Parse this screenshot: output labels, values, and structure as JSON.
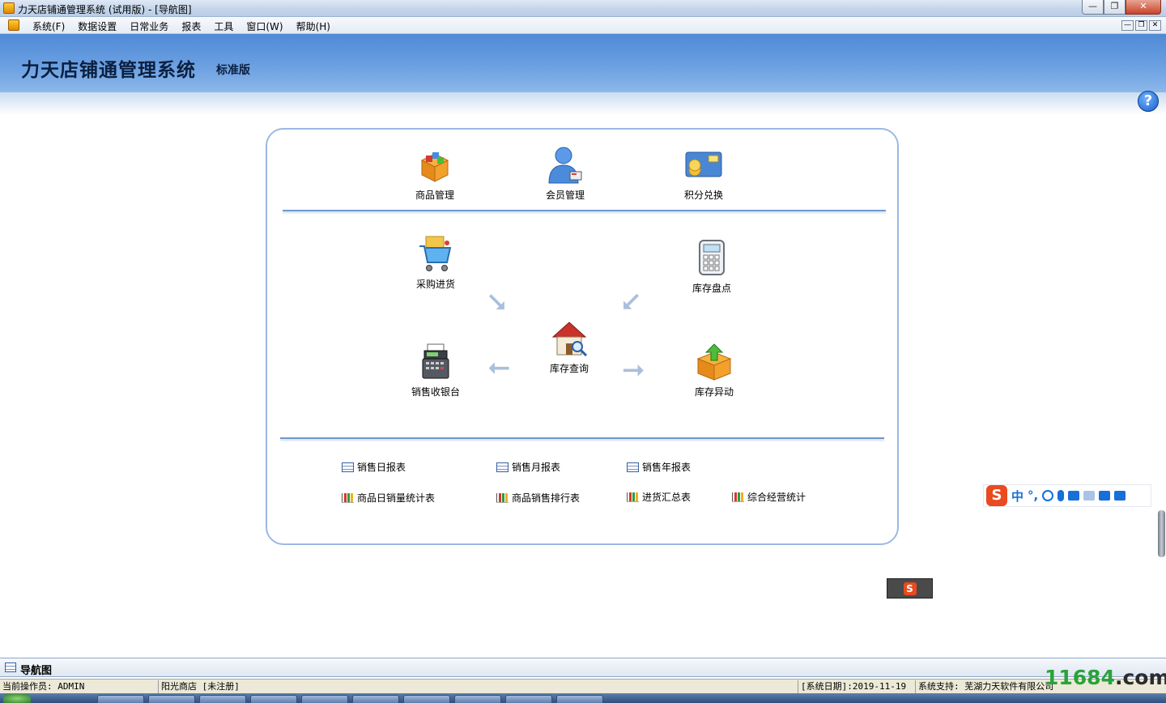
{
  "window": {
    "title": "力天店铺通管理系统 (试用版) - [导航图]",
    "min_glyph": "—",
    "max_glyph": "❐",
    "close_glyph": "✕"
  },
  "menu": {
    "items": [
      "系统(F)",
      "数据设置",
      "日常业务",
      "报表",
      "工具",
      "窗口(W)",
      "帮助(H)"
    ]
  },
  "banner": {
    "title": "力天店铺通管理系统",
    "edition": "标准版",
    "help_glyph": "?"
  },
  "modules": {
    "goods": "商品管理",
    "member": "会员管理",
    "points": "积分兑换",
    "purchase": "采购进货",
    "inventory_check": "库存盘点",
    "inventory_query": "库存查询",
    "pos": "销售收银台",
    "inventory_change": "库存异动"
  },
  "reports": {
    "daily": "销售日报表",
    "monthly": "销售月报表",
    "yearly": "销售年报表",
    "goods_daily": "商品日销量统计表",
    "goods_rank": "商品销售排行表",
    "purchase_summary": "进货汇总表",
    "overall": "综合经营统计"
  },
  "ime": {
    "logo": "S",
    "mode": "中",
    "punct": "°,"
  },
  "navtab": {
    "label": "导航图"
  },
  "status": {
    "operator": "当前操作员: ADMIN",
    "shop": "阳光商店 [未注册]",
    "date": "[系统日期]:2019-11-19",
    "support": "系统支持: 芜湖力天软件有限公司"
  },
  "watermark": {
    "green": "11684",
    "dark": ".com"
  },
  "colors": {
    "banner": "#5b93dc",
    "panel_border": "#9bb9e2",
    "divider": "#6e98cf",
    "arrow": "#a9bfdc"
  }
}
